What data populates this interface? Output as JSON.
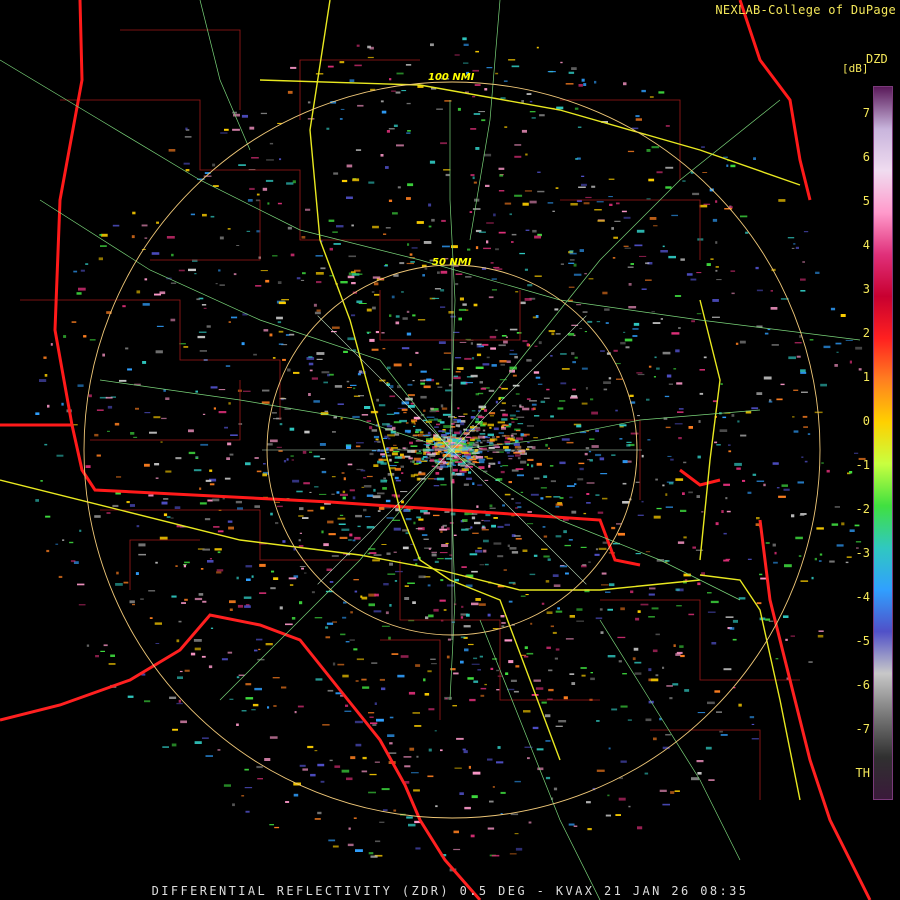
{
  "header": {
    "credit": "NEXLAB-College of DuPage"
  },
  "legend": {
    "product_code": "DZD",
    "unit": "dB",
    "ticks": [
      "7",
      "6",
      "5",
      "4",
      "3",
      "2",
      "1",
      "0",
      "-1",
      "-2",
      "-3",
      "-4",
      "-5",
      "-6",
      "-7",
      "TH"
    ],
    "colors": [
      "#5a1a5a",
      "#c8b4dc",
      "#f0dcf0",
      "#ff9acb",
      "#e0307a",
      "#c80030",
      "#ff2020",
      "#ff8020",
      "#ffd000",
      "#c8ff40",
      "#40e040",
      "#30c8c0",
      "#30a0ff",
      "#5050c8",
      "#c8c8c8",
      "#787878",
      "#303030",
      "#3a1a3a"
    ]
  },
  "range_rings": {
    "labels": [
      "100 NMI",
      "50 NMI"
    ]
  },
  "footer": {
    "text": "DIFFERENTIAL REFLECTIVITY (ZDR) 0.5 DEG - KVAX 21 JAN 26 08:35"
  }
}
